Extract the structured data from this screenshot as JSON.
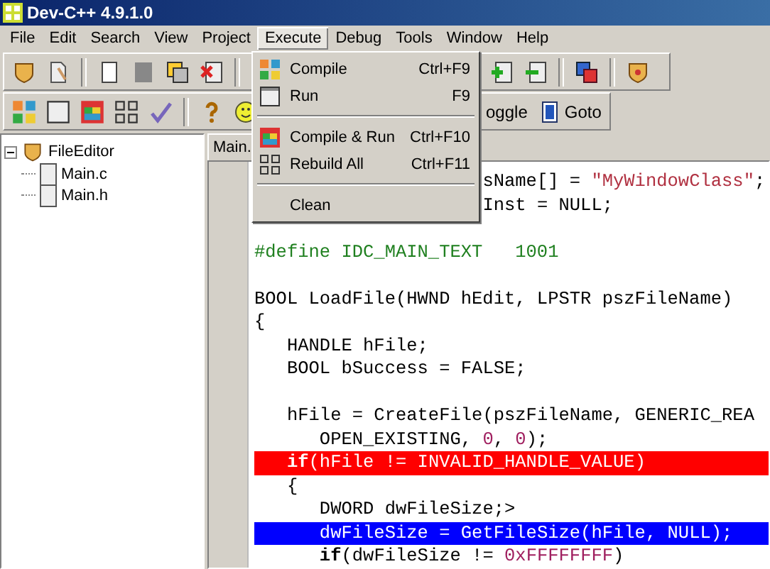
{
  "window": {
    "title": "Dev-C++ 4.9.1.0"
  },
  "menu_bar": [
    {
      "label": "File",
      "selected": false
    },
    {
      "label": "Edit",
      "selected": false
    },
    {
      "label": "Search",
      "selected": false
    },
    {
      "label": "View",
      "selected": false
    },
    {
      "label": "Project",
      "selected": false
    },
    {
      "label": "Execute",
      "selected": true
    },
    {
      "label": "Debug",
      "selected": false
    },
    {
      "label": "Tools",
      "selected": false
    },
    {
      "label": "Window",
      "selected": false
    },
    {
      "label": "Help",
      "selected": false
    }
  ],
  "toolbar_2_buttons": [
    {
      "label": "oggle"
    },
    {
      "label": "Goto"
    }
  ],
  "project_tree": [
    {
      "label": "FileEditor",
      "expanded": true,
      "children": [
        {
          "label": "Main.c"
        },
        {
          "label": "Main.h"
        }
      ]
    }
  ],
  "editor_tabs": [
    {
      "label": "Main.",
      "selected": true
    }
  ],
  "code_lines": [
    {
      "kind": "normal",
      "segments": [
        {
          "text": "                     sName[] = ",
          "kind": "plain"
        },
        {
          "text": "\"MyWindowClass\"",
          "kind": "string"
        },
        {
          "text": ";",
          "kind": "plain"
        }
      ]
    },
    {
      "kind": "normal",
      "segments": [
        {
          "text": "                     Inst = NULL;",
          "kind": "plain"
        }
      ]
    },
    {
      "kind": "blank"
    },
    {
      "kind": "normal",
      "segments": [
        {
          "text": "#define IDC_MAIN_TEXT   1001",
          "kind": "preprocessor"
        }
      ]
    },
    {
      "kind": "blank"
    },
    {
      "kind": "normal",
      "segments": [
        {
          "text": "BOOL LoadFile(HWND hEdit, LPSTR pszFileName)",
          "kind": "plain"
        }
      ]
    },
    {
      "kind": "normal",
      "segments": [
        {
          "text": "{",
          "kind": "plain"
        }
      ]
    },
    {
      "kind": "normal",
      "segments": [
        {
          "text": "   HANDLE hFile;",
          "kind": "plain"
        }
      ]
    },
    {
      "kind": "normal",
      "segments": [
        {
          "text": "   BOOL bSuccess = FALSE;",
          "kind": "plain"
        }
      ]
    },
    {
      "kind": "blank"
    },
    {
      "kind": "normal",
      "segments": [
        {
          "text": "   hFile = CreateFile(pszFileName, GENERIC_REA",
          "kind": "plain"
        }
      ]
    },
    {
      "kind": "normal",
      "segments": [
        {
          "text": "      OPEN_EXISTING, ",
          "kind": "plain"
        },
        {
          "text": "0",
          "kind": "number"
        },
        {
          "text": ", ",
          "kind": "plain"
        },
        {
          "text": "0",
          "kind": "number"
        },
        {
          "text": ");",
          "kind": "plain"
        }
      ]
    },
    {
      "kind": "error",
      "segments": [
        {
          "text": "   if",
          "kind": "keyword"
        },
        {
          "text": "(hFile != INVALID_HANDLE_VALUE)",
          "kind": "plain"
        }
      ]
    },
    {
      "kind": "normal",
      "segments": [
        {
          "text": "   {",
          "kind": "plain"
        }
      ]
    },
    {
      "kind": "normal",
      "segments": [
        {
          "text": "      DWORD dwFileSize;>",
          "kind": "plain"
        }
      ]
    },
    {
      "kind": "selected",
      "segments": [
        {
          "text": "      dwFileSize = GetFileSize(hFile, NULL);",
          "kind": "plain"
        }
      ]
    },
    {
      "kind": "normal",
      "segments": [
        {
          "text": "      if",
          "kind": "keyword"
        },
        {
          "text": "(dwFileSize != ",
          "kind": "plain"
        },
        {
          "text": "0xFFFFFFFF",
          "kind": "number"
        },
        {
          "text": ")",
          "kind": "plain"
        }
      ]
    }
  ],
  "execute_menu": [
    {
      "kind": "item",
      "label": "Compile",
      "shortcut": "Ctrl+F9"
    },
    {
      "kind": "item",
      "label": "Run",
      "shortcut": "F9"
    },
    {
      "kind": "separator"
    },
    {
      "kind": "item",
      "label": "Compile & Run",
      "shortcut": "Ctrl+F10"
    },
    {
      "kind": "item",
      "label": "Rebuild All",
      "shortcut": "Ctrl+F11"
    },
    {
      "kind": "separator"
    },
    {
      "kind": "item",
      "label": "Clean"
    }
  ]
}
